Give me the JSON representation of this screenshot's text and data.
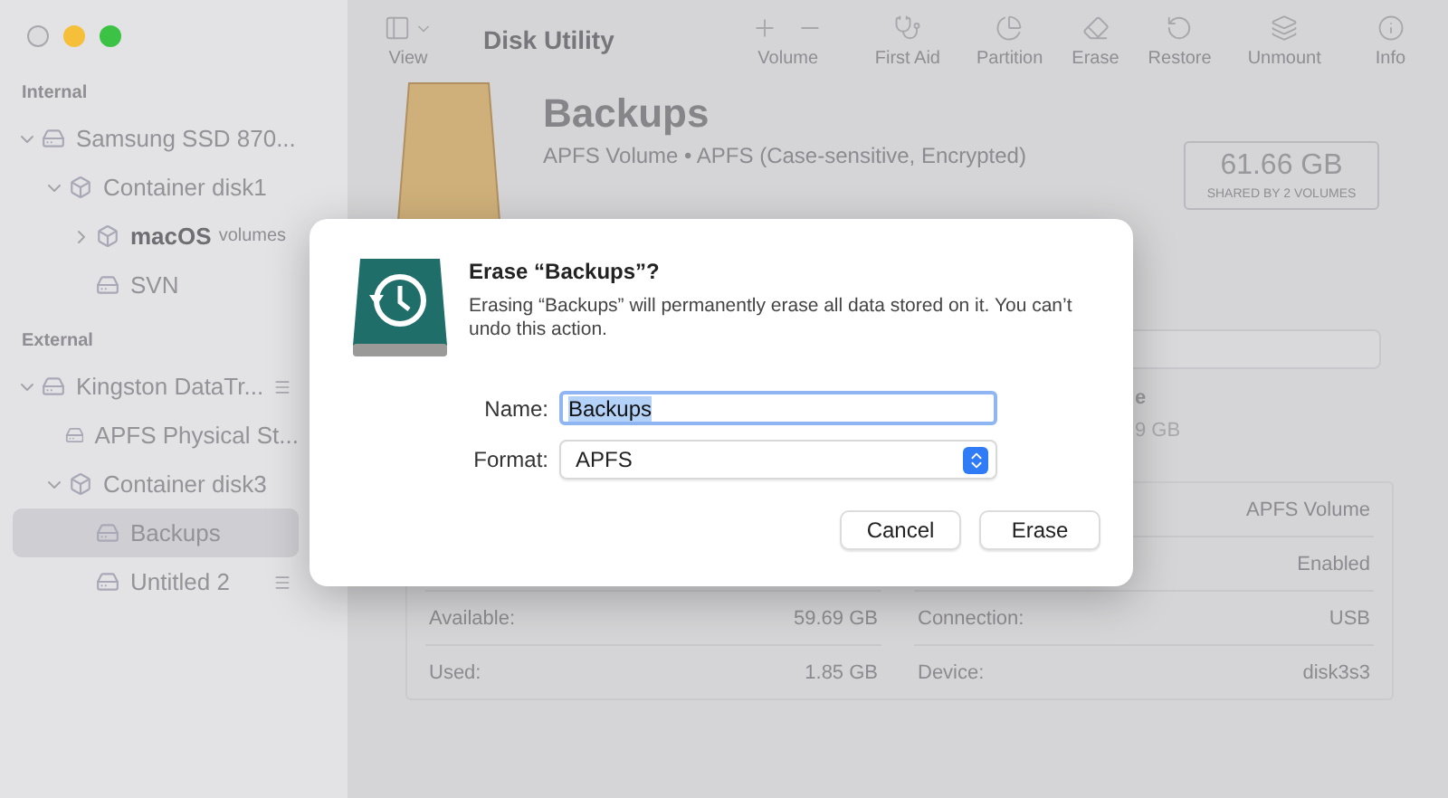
{
  "window": {
    "title": "Disk Utility",
    "controls": [
      {
        "kind": "close",
        "color": "#dcdbde"
      },
      {
        "kind": "minimize",
        "color": "#f6bf3a"
      },
      {
        "kind": "zoom",
        "color": "#3cc245"
      }
    ]
  },
  "toolbar": {
    "view_label": "View",
    "buttons": [
      {
        "kind": "volume",
        "label": "Volume"
      },
      {
        "kind": "first_aid",
        "label": "First Aid"
      },
      {
        "kind": "partition",
        "label": "Partition"
      },
      {
        "kind": "erase",
        "label": "Erase"
      },
      {
        "kind": "restore",
        "label": "Restore"
      },
      {
        "kind": "unmount",
        "label": "Unmount"
      },
      {
        "kind": "info",
        "label": "Info"
      }
    ]
  },
  "sidebar": {
    "sections": [
      {
        "heading": "Internal",
        "items": [
          {
            "kind": "disk",
            "label": "Samsung SSD 870...",
            "expanded": true,
            "selected": false,
            "bold": false,
            "eject": false,
            "children": [
              {
                "kind": "container",
                "label": "Container disk1",
                "expanded": true,
                "selected": false,
                "bold": false,
                "eject": false,
                "children": [
                  {
                    "kind": "container",
                    "label": "macOS",
                    "note": "volumes",
                    "expanded": false,
                    "selected": false,
                    "bold": true,
                    "eject": false
                  },
                  {
                    "kind": "disk",
                    "label": "SVN",
                    "selected": false,
                    "bold": false,
                    "eject": false
                  }
                ]
              }
            ]
          }
        ]
      },
      {
        "heading": "External",
        "items": [
          {
            "kind": "disk",
            "label": "Kingston DataTr...",
            "expanded": true,
            "selected": false,
            "bold": false,
            "eject": true,
            "children": [
              {
                "kind": "disk",
                "label": "APFS Physical St...",
                "selected": false,
                "bold": false,
                "eject": false
              },
              {
                "kind": "container",
                "label": "Container disk3",
                "expanded": true,
                "selected": false,
                "bold": false,
                "eject": false,
                "children": [
                  {
                    "kind": "disk",
                    "label": "Backups",
                    "selected": true,
                    "bold": false,
                    "eject": false
                  },
                  {
                    "kind": "disk",
                    "label": "Untitled 2",
                    "selected": false,
                    "bold": false,
                    "eject": true
                  }
                ]
              }
            ]
          }
        ]
      }
    ]
  },
  "volume": {
    "name": "Backups",
    "subtitle": "APFS Volume • APFS (Case-sensitive, Encrypted)",
    "capacity": "61.66 GB",
    "capacity_note": "SHARED BY 2 VOLUMES"
  },
  "usage": {
    "legend_name": "e",
    "legend_value": "9 GB"
  },
  "info_table": {
    "rows": [
      {
        "right_value": "APFS Volume"
      },
      {
        "right_value": "Enabled"
      },
      {
        "left_label": "Available:",
        "left_value": "59.69 GB",
        "right_label": "Connection:",
        "right_value": "USB"
      },
      {
        "left_label": "Used:",
        "left_value": "1.85 GB",
        "right_label": "Device:",
        "right_value": "disk3s3"
      }
    ]
  },
  "dialog": {
    "title": "Erase “Backups”?",
    "message": "Erasing “Backups” will permanently erase all data stored on it. You can’t undo this action.",
    "name_label": "Name:",
    "name_value": "Backups",
    "name_selected": true,
    "format_label": "Format:",
    "format_value": "APFS",
    "buttons": [
      "Cancel",
      "Erase"
    ]
  }
}
